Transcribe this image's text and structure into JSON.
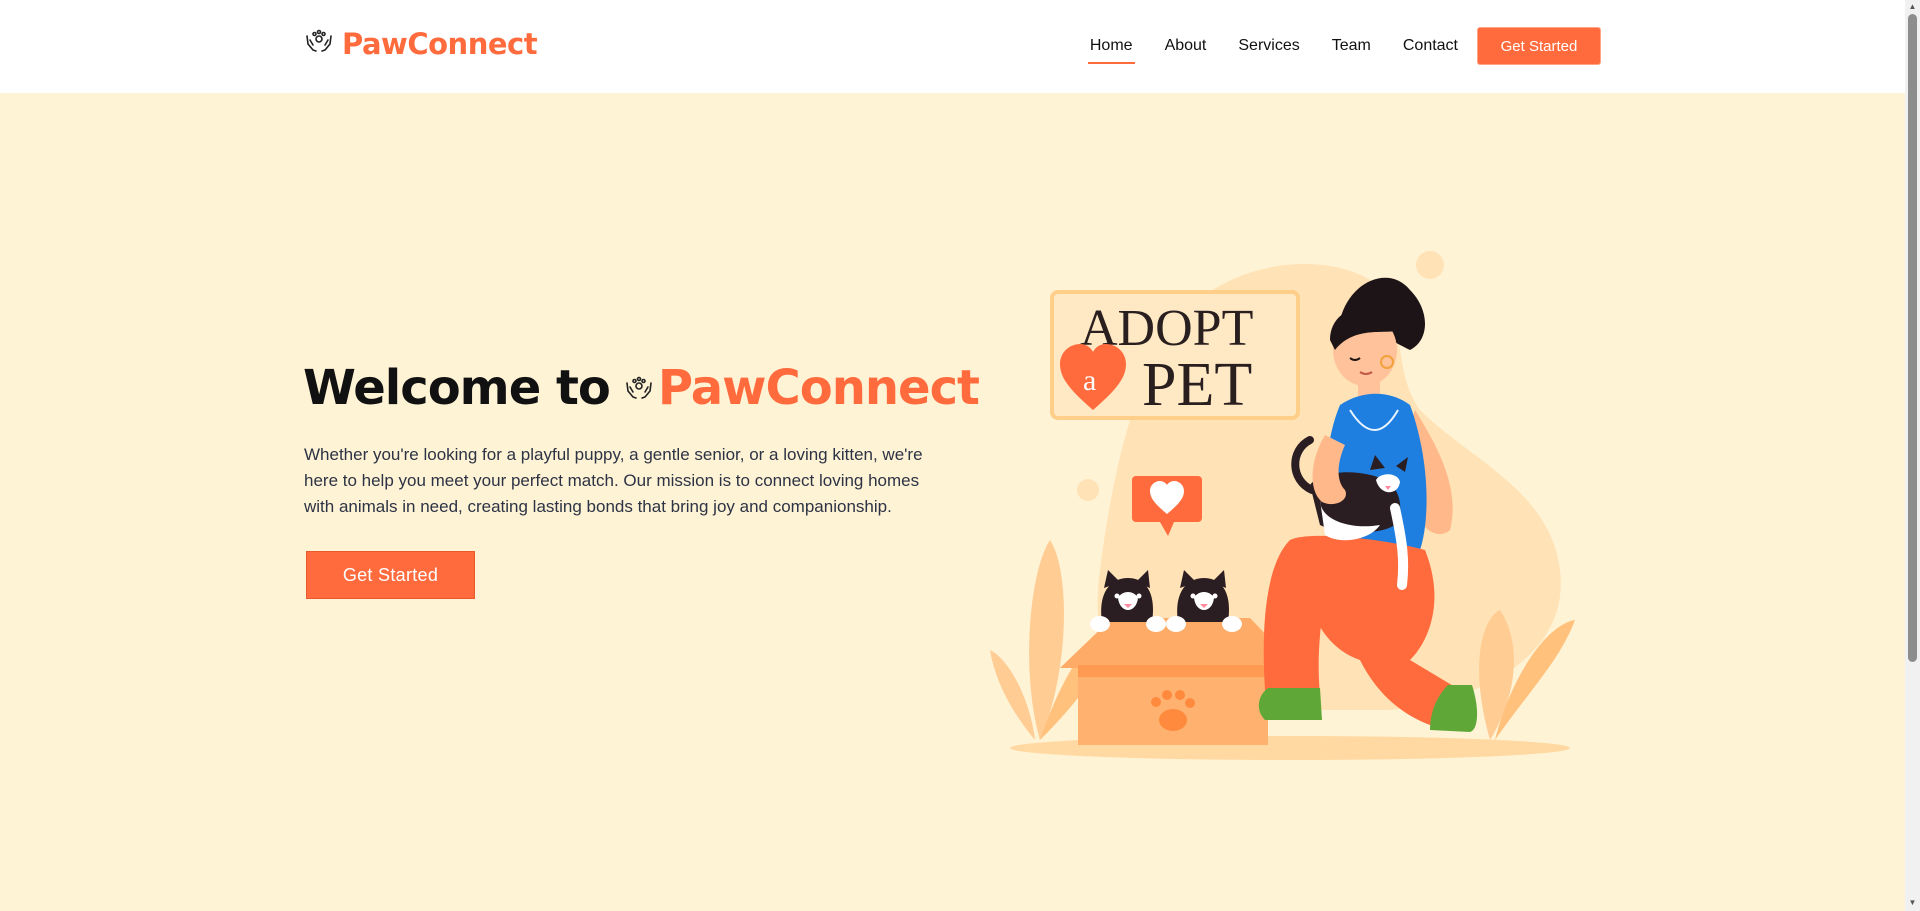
{
  "brand": {
    "name": "PawConnect",
    "icon": "hands-holding-paw-icon"
  },
  "nav": {
    "items": [
      {
        "label": "Home",
        "active": true
      },
      {
        "label": "About",
        "active": false
      },
      {
        "label": "Services",
        "active": false
      },
      {
        "label": "Team",
        "active": false
      },
      {
        "label": "Contact",
        "active": false
      }
    ],
    "cta_label": "Get Started"
  },
  "hero": {
    "title_prefix": "Welcome to",
    "title_brand": "PawConnect",
    "description": "Whether you're looking for a playful puppy, a gentle senior, or a loving kitten, we're here to help you meet your perfect match. Our mission is to connect loving homes with animals in need, creating lasting bonds that bring joy and companionship.",
    "button_label": "Get Started"
  },
  "illustration": {
    "sign_line1": "ADOPT",
    "sign_heart_letter": "a",
    "sign_line2": "PET"
  },
  "colors": {
    "accent": "#ff6b3d",
    "hero_bg": "#fff3d6",
    "text_dark": "#111111"
  }
}
